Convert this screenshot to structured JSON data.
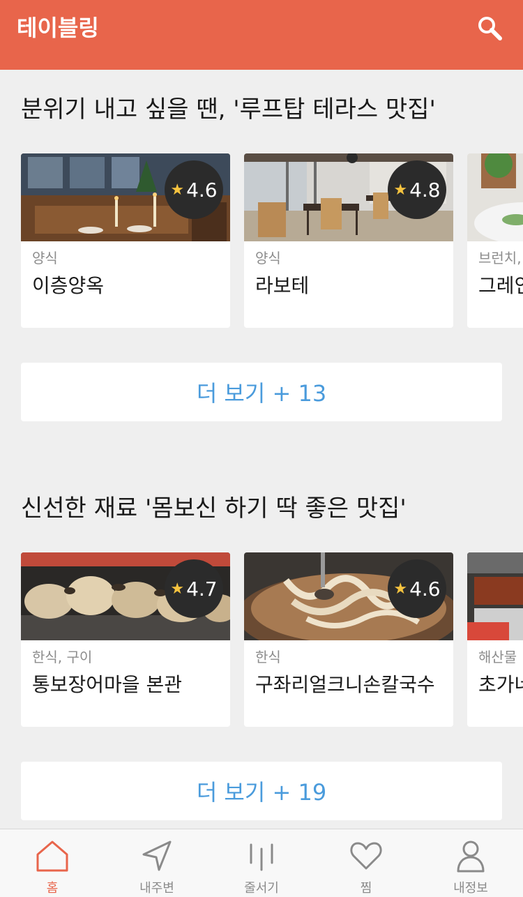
{
  "header": {
    "title": "테이블링",
    "search_icon": "search-icon"
  },
  "sections": [
    {
      "title": "분위기 내고 싶을 땐, '루프탑 테라스 맛집'",
      "cards": [
        {
          "rating": "4.6",
          "category": "양식",
          "name": "이층양옥"
        },
        {
          "rating": "4.8",
          "category": "양식",
          "name": "라보테"
        },
        {
          "rating": "",
          "category": "브런치,",
          "name": "그레인"
        }
      ],
      "more_label": "더 보기 + 13"
    },
    {
      "title": "신선한 재료 '몸보신 하기 딱 좋은 맛집'",
      "cards": [
        {
          "rating": "4.7",
          "category": "한식, 구이",
          "name": "통보장어마을 본관"
        },
        {
          "rating": "4.6",
          "category": "한식",
          "name": "구좌리얼크니손칼국수"
        },
        {
          "rating": "",
          "category": "해산물",
          "name": "초가네"
        }
      ],
      "more_label": "더 보기 + 19"
    }
  ],
  "tabbar": {
    "active": "홈",
    "tabs": [
      {
        "label": "홈",
        "icon": "home-icon"
      },
      {
        "label": "내주변",
        "icon": "navigation-arrow-icon"
      },
      {
        "label": "줄서기",
        "icon": "queue-icon"
      },
      {
        "label": "찜",
        "icon": "heart-icon"
      },
      {
        "label": "내정보",
        "icon": "person-icon"
      }
    ]
  },
  "colors": {
    "accent": "#e8654b",
    "link": "#4a9bdc",
    "star": "#f6c33f"
  }
}
